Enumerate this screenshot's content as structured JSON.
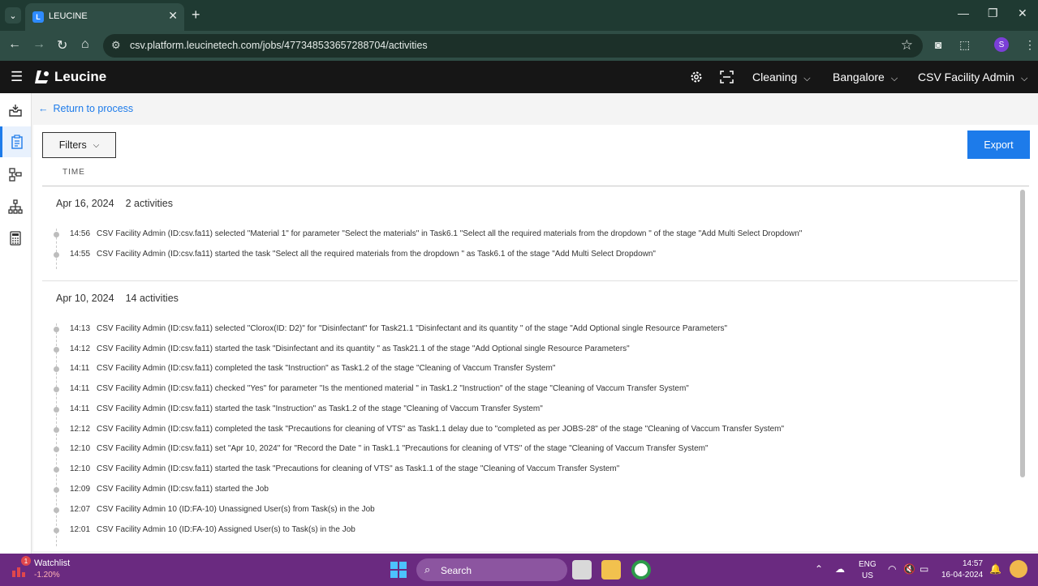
{
  "browser": {
    "tab_title": "LEUCINE",
    "url": "csv.platform.leucinetech.com/jobs/477348533657288704/activities",
    "profile_initial": "S"
  },
  "header": {
    "brand": "Leucine",
    "selects": [
      "Cleaning",
      "Bangalore",
      "CSV Facility Admin"
    ]
  },
  "page": {
    "back_label": "Return to process",
    "filters_label": "Filters",
    "export_label": "Export",
    "time_column": "TIME"
  },
  "days": [
    {
      "date": "Apr 16, 2024",
      "count": "2 activities",
      "activities": [
        {
          "time": "14:56",
          "text": "CSV Facility Admin (ID:csv.fa11) selected \"Material 1\" for parameter \"Select the materials\" in Task6.1 \"Select all the required materials from the dropdown \" of the stage \"Add Multi Select Dropdown\""
        },
        {
          "time": "14:55",
          "text": "CSV Facility Admin (ID:csv.fa11) started the task \"Select all the required materials from the dropdown \" as Task6.1 of the stage \"Add Multi Select Dropdown\""
        }
      ]
    },
    {
      "date": "Apr 10, 2024",
      "count": "14 activities",
      "activities": [
        {
          "time": "14:13",
          "text": "CSV Facility Admin (ID:csv.fa11) selected \"Clorox(ID: D2)\" for \"Disinfectant\" for Task21.1 \"Disinfectant and its quantity \" of the stage \"Add Optional single Resource Parameters\""
        },
        {
          "time": "14:12",
          "text": "CSV Facility Admin (ID:csv.fa11) started the task \"Disinfectant and its quantity \" as Task21.1 of the stage \"Add Optional single Resource Parameters\""
        },
        {
          "time": "14:11",
          "text": "CSV Facility Admin (ID:csv.fa11) completed the task \"Instruction\" as Task1.2 of the stage \"Cleaning of Vaccum Transfer System\""
        },
        {
          "time": "14:11",
          "text": "CSV Facility Admin (ID:csv.fa11) checked \"Yes\" for parameter \"Is the mentioned material \" in Task1.2 \"Instruction\" of the stage \"Cleaning of Vaccum Transfer System\""
        },
        {
          "time": "14:11",
          "text": "CSV Facility Admin (ID:csv.fa11) started the task \"Instruction\" as Task1.2 of the stage \"Cleaning of Vaccum Transfer System\""
        },
        {
          "time": "12:12",
          "text": "CSV Facility Admin (ID:csv.fa11) completed the task \"Precautions for cleaning of VTS\" as Task1.1 delay due to \"completed as per JOBS-28\" of the stage \"Cleaning of Vaccum Transfer System\""
        },
        {
          "time": "12:10",
          "text": "CSV Facility Admin (ID:csv.fa11) set \"Apr 10, 2024\" for \"Record the Date \" in Task1.1 \"Precautions for cleaning of VTS\" of the stage \"Cleaning of Vaccum Transfer System\""
        },
        {
          "time": "12:10",
          "text": "CSV Facility Admin (ID:csv.fa11) started the task \"Precautions for cleaning of VTS\" as Task1.1 of the stage \"Cleaning of Vaccum Transfer System\""
        },
        {
          "time": "12:09",
          "text": "CSV Facility Admin (ID:csv.fa11) started the Job"
        },
        {
          "time": "12:07",
          "text": "CSV Facility Admin 10 (ID:FA-10) Unassigned User(s) from Task(s) in the Job"
        },
        {
          "time": "12:01",
          "text": "CSV Facility Admin 10 (ID:FA-10) Assigned User(s) to Task(s) in the Job"
        }
      ]
    }
  ],
  "taskbar": {
    "watchlist_title": "Watchlist",
    "watchlist_change": "-1.20%",
    "watchlist_badge": "1",
    "search_label": "Search",
    "lang_1": "ENG",
    "lang_2": "US",
    "clock_time": "14:57",
    "clock_date": "16-04-2024"
  },
  "colors": {
    "accent": "#1d7bea",
    "chrome_dark": "#1f3a32",
    "app_header": "#161616",
    "taskbar": "#6a2a80"
  }
}
